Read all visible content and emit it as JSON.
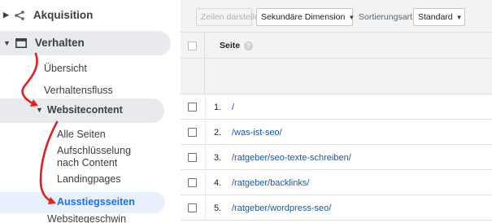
{
  "sidebar": {
    "akquisition": {
      "label": "Akquisition",
      "icon": "acquisition-icon"
    },
    "verhalten": {
      "label": "Verhalten",
      "icon": "behavior-icon"
    },
    "uebersicht": "Übersicht",
    "verhaltensfluss": "Verhaltensfluss",
    "websitecontent": "Websitecontent",
    "alle_seiten": "Alle Seiten",
    "aufschluesselung": "Aufschlüsselung nach Content",
    "landingpages": "Landingpages",
    "ausstiegsseiten": "Ausstiegsseiten",
    "websitegeschwin": "Websitegeschwin"
  },
  "toolbar": {
    "zeilen_label": "Zeilen darstellen",
    "sekundaer_label": "Sekundäre Dimension",
    "sort_label": "Sortierungsart:",
    "sort_value": "Standard"
  },
  "table": {
    "column_header": "Seite",
    "help_glyph": "?",
    "rows": [
      {
        "num": "1.",
        "page": "/"
      },
      {
        "num": "2.",
        "page": "/was-ist-seo/"
      },
      {
        "num": "3.",
        "page": "/ratgeber/seo-texte-schreiben/"
      },
      {
        "num": "4.",
        "page": "/ratgeber/backlinks/"
      },
      {
        "num": "5.",
        "page": "/ratgeber/wordpress-seo/"
      }
    ]
  },
  "colors": {
    "accent": "#1a73e8",
    "link": "#1a56a8",
    "annotation_arrow": "#e02020",
    "selected_bg": "#e8f0fe"
  }
}
